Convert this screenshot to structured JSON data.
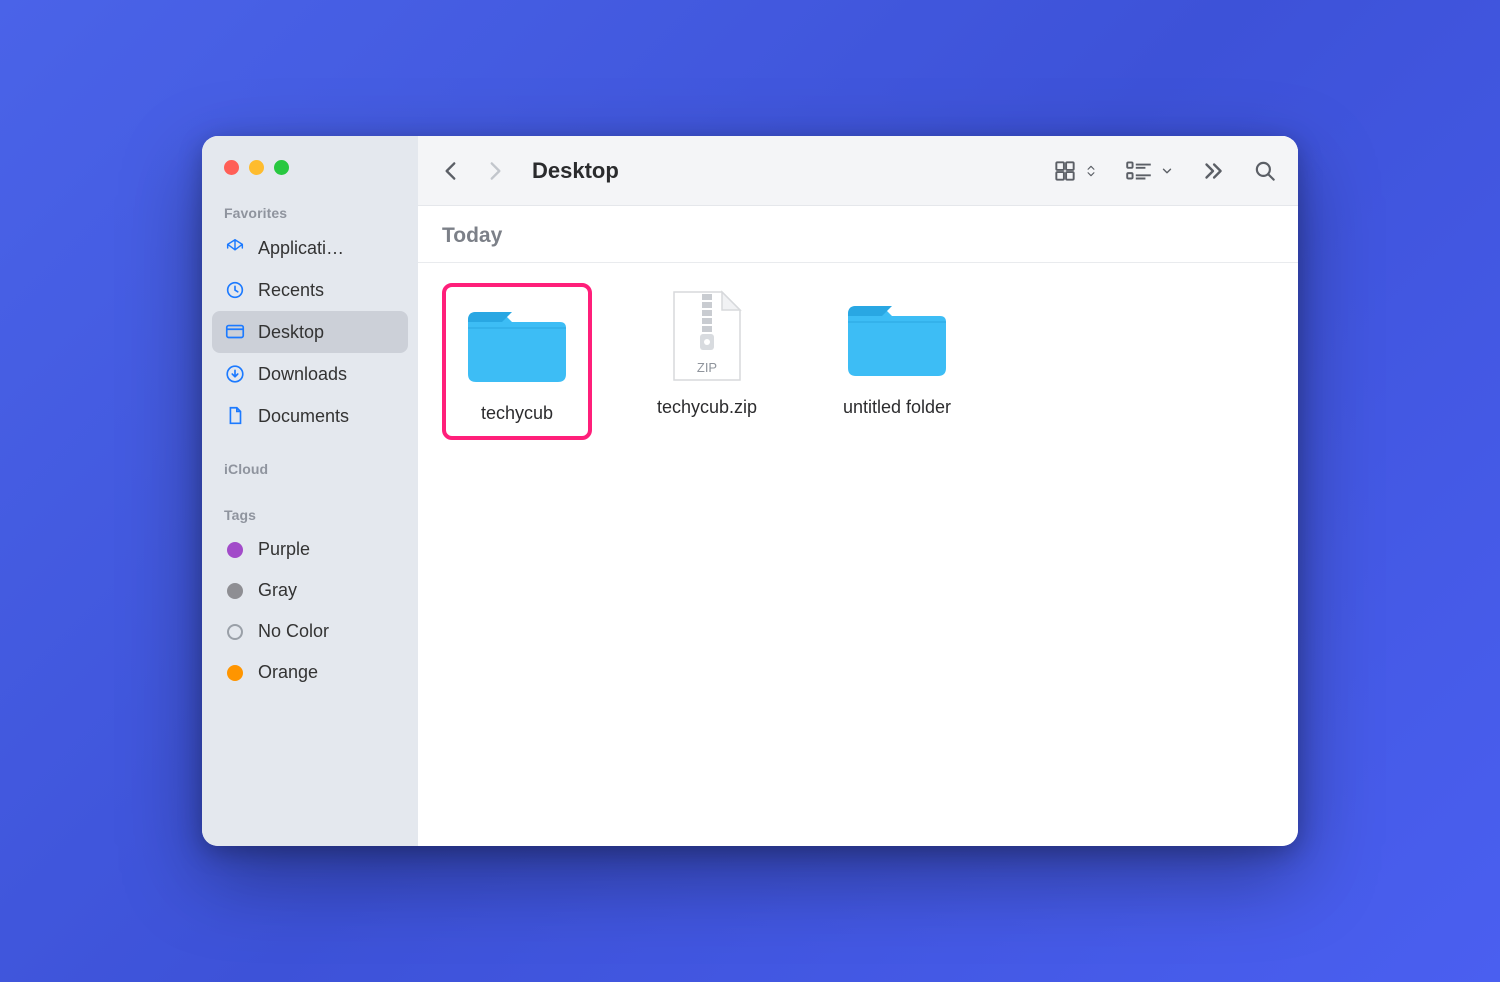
{
  "window": {
    "title": "Desktop"
  },
  "sidebar": {
    "sections": [
      {
        "label": "Favorites",
        "items": [
          {
            "icon": "applications-icon",
            "label": "Applicati…"
          },
          {
            "icon": "recents-icon",
            "label": "Recents"
          },
          {
            "icon": "desktop-icon",
            "label": "Desktop",
            "active": true
          },
          {
            "icon": "downloads-icon",
            "label": "Downloads"
          },
          {
            "icon": "documents-icon",
            "label": "Documents"
          }
        ]
      },
      {
        "label": "iCloud",
        "items": []
      },
      {
        "label": "Tags",
        "items": [
          {
            "tagColor": "purple",
            "label": "Purple"
          },
          {
            "tagColor": "gray",
            "label": "Gray"
          },
          {
            "tagColor": "none",
            "label": "No Color"
          },
          {
            "tagColor": "orange",
            "label": "Orange"
          }
        ]
      }
    ]
  },
  "content": {
    "group_header": "Today",
    "items": [
      {
        "type": "folder",
        "name": "techycub",
        "highlighted": true
      },
      {
        "type": "zip",
        "name": "techycub.zip",
        "zip_label": "ZIP"
      },
      {
        "type": "folder",
        "name": "untitled folder"
      }
    ]
  }
}
